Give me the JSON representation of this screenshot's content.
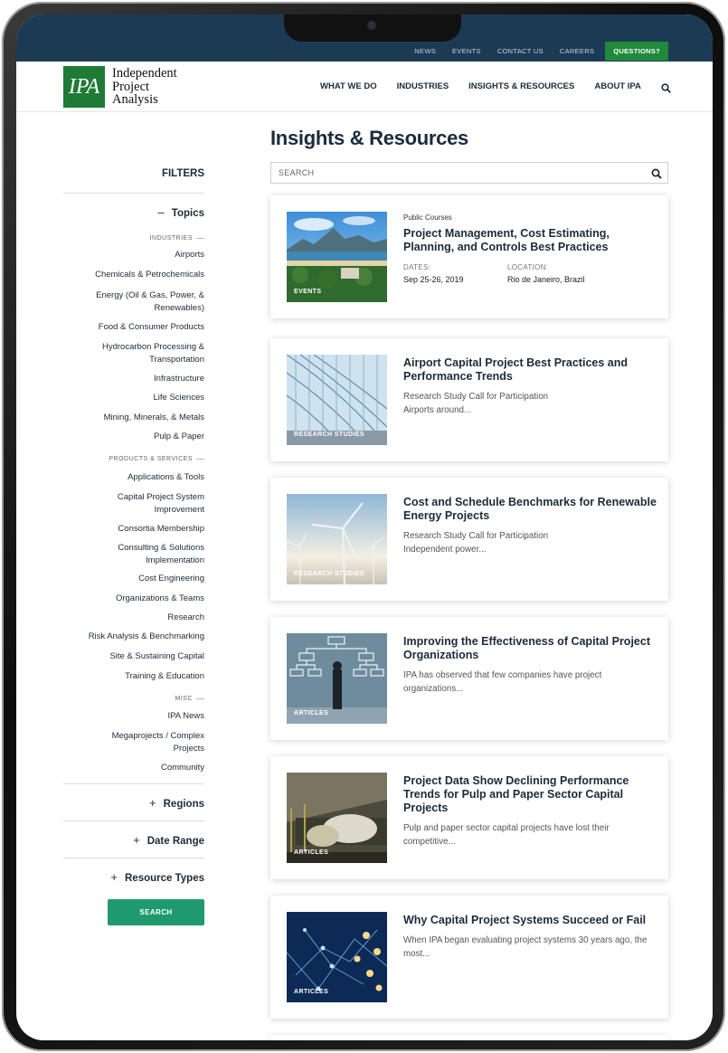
{
  "topbar": {
    "links": [
      "NEWS",
      "EVENTS",
      "CONTACT US",
      "CAREERS"
    ],
    "cta": "QUESTIONS?"
  },
  "brand": {
    "mark": "IPA",
    "name": "Independent\nProject\nAnalysis"
  },
  "nav": {
    "items": [
      "WHAT WE DO",
      "INDUSTRIES",
      "INSIGHTS & RESOURCES",
      "ABOUT IPA"
    ]
  },
  "sidebar": {
    "title": "FILTERS",
    "topics_label": "Topics",
    "industries_label": "INDUSTRIES",
    "industries": [
      "Airports",
      "Chemicals & Petrochemicals",
      "Energy (Oil & Gas, Power, &\nRenewables)",
      "Food & Consumer Products",
      "Hydrocarbon Processing &\nTransportation",
      "Infrastructure",
      "Life Sciences",
      "Mining, Minerals, & Metals",
      "Pulp & Paper"
    ],
    "products_label": "PRODUCTS & SERVICES",
    "products": [
      "Applications & Tools",
      "Capital Project System\nImprovement",
      "Consortia Membership",
      "Consulting & Solutions\nImplementation",
      "Cost Engineering",
      "Organizations & Teams",
      "Research",
      "Risk Analysis & Benchmarking",
      "Site & Sustaining Capital",
      "Training & Education"
    ],
    "misc_label": "MISC",
    "misc": [
      "IPA News",
      "Megaprojects / Complex\nProjects",
      "Community"
    ],
    "regions_label": "Regions",
    "date_label": "Date Range",
    "types_label": "Resource Types",
    "search_button": "SEARCH"
  },
  "main": {
    "title": "Insights & Resources",
    "search_placeholder": "SEARCH",
    "cards": [
      {
        "tag": "EVENTS",
        "kicker": "Public Courses",
        "title": "Project Management, Cost Estimating, Planning, and Controls Best Practices",
        "dates_label": "DATES:",
        "dates": "Sep 25-26, 2019",
        "location_label": "LOCATION:",
        "location": "Rio de Janeiro, Brazil"
      },
      {
        "tag": "RESEARCH STUDIES",
        "title": "Airport Capital Project Best Practices and Performance Trends",
        "desc": "Research Study Call for Participation\nAirports around..."
      },
      {
        "tag": "RESEARCH STUDIES",
        "title": "Cost and Schedule Benchmarks for Renewable Energy Projects",
        "desc": "Research Study Call for Participation\nIndependent power..."
      },
      {
        "tag": "ARTICLES",
        "title": "Improving the Effectiveness of Capital Project Organizations",
        "desc": "IPA has observed that few companies have project organizations..."
      },
      {
        "tag": "ARTICLES",
        "title": "Project Data Show Declining Performance Trends for Pulp and Paper Sector Capital Projects",
        "desc": "Pulp and paper sector capital projects have lost their competitive..."
      },
      {
        "tag": "ARTICLES",
        "title": "Why Capital Project Systems Succeed or Fail",
        "desc": "When IPA began evaluating project systems 30 years ago, the most..."
      }
    ]
  },
  "colors": {
    "navy": "#1d3a55",
    "green": "#1f7a36",
    "button": "#1f9a6e"
  }
}
